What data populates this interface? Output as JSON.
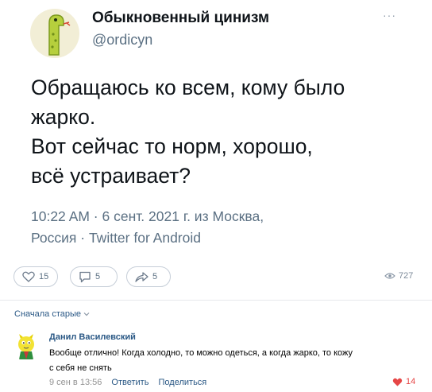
{
  "tweet": {
    "author_name": "Обыкновенный цинизм",
    "author_handle": "@ordicyn",
    "more_label": "···",
    "text_lines": [
      "Обращаюсь ко всем, кому было",
      "жарко.",
      "Вот сейчас то норм, хорошо,",
      "всё устраивает?"
    ],
    "meta_line_1": "10:22 AM · 6 сент. 2021 г. из Москва,",
    "meta_location_2": "Россия",
    "meta_separator": " · ",
    "meta_source": "Twitter for Android"
  },
  "post_actions": {
    "likes": "15",
    "comments": "5",
    "shares": "5",
    "views": "727",
    "icons": [
      "heart-outline-icon",
      "comment-bubble-icon",
      "share-arrow-icon",
      "eye-icon"
    ]
  },
  "comments": {
    "sort_label": "Сначала старые",
    "items": [
      {
        "author": "Данил Василевский",
        "text_lines": [
          "Вообще отлично! Когда холодно, то можно одеться, а когда жарко, то кожу",
          "с себя не снять"
        ],
        "time": "9 сен в 13:56",
        "reply_label": "Ответить",
        "share_label": "Поделиться",
        "likes": "14"
      }
    ]
  },
  "colors": {
    "link": "#2a5885",
    "muted": "#5b7083",
    "like_active": "#e64646",
    "snake": "#b6cf3d"
  }
}
